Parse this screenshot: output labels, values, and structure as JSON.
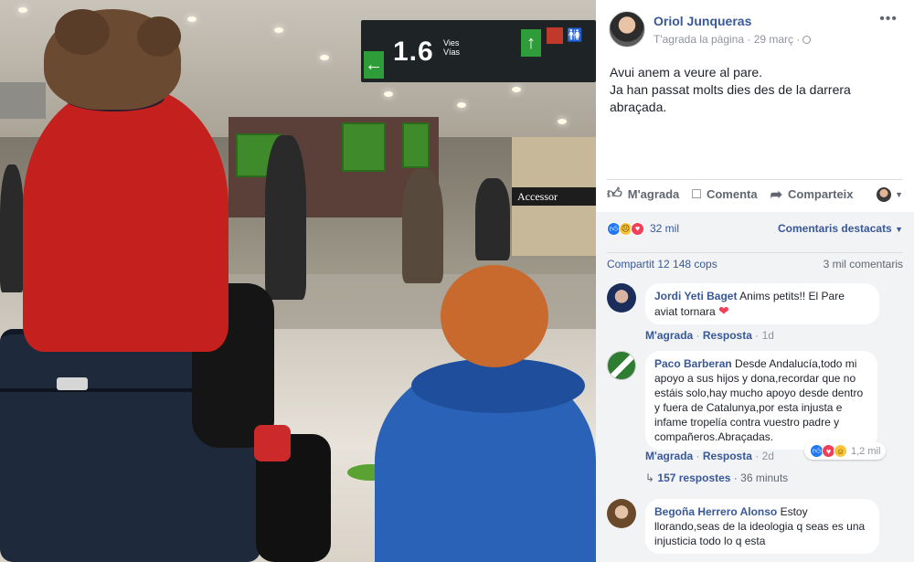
{
  "photo": {
    "sign": {
      "number": "1.6",
      "small_top": "Vies",
      "small_bottom": "Vías"
    },
    "store_sign": "Accessor"
  },
  "post": {
    "author": "Oriol Junqueras",
    "subtitle": "T'agrada la pàgina · 29 març ·",
    "more_icon": "more-options-icon",
    "text_line1": "Avui anem a veure al pare.",
    "text_line2": "Ja han passat molts dies des de la darrera abraçada."
  },
  "actions": {
    "like": "M'agrada",
    "comment": "Comenta",
    "share": "Comparteix"
  },
  "stats": {
    "reactions_count": "32 mil",
    "top_comments": "Comentaris destacats",
    "shares": "Compartit 12 148 cops",
    "comments": "3 mil comentaris"
  },
  "comments": [
    {
      "name": "Jordi Yeti Baget",
      "text": "Anims petits!! El Pare aviat tornara",
      "like": "M'agrada",
      "reply": "Resposta",
      "time": "1d"
    },
    {
      "name": "Paco Barberan",
      "text": "Desde Andalucía,todo mi apoyo a sus hijos y dona,recordar que no estáis solo,hay mucho apoyo desde dentro y fuera de Catalunya,por esta injusta e infame tropelía contra vuestro padre y compañeros.Abraçadas.",
      "like": "M'agrada",
      "reply": "Resposta",
      "time": "2d",
      "reaction_count": "1,2 mil",
      "replies": "157 respostes",
      "replies_time": "36 minuts"
    },
    {
      "name": "Begoña Herrero Alonso",
      "text": "Estoy llorando,seas de la ideologia q seas es una injusticia todo lo q esta"
    }
  ],
  "colors": {
    "link": "#385898",
    "like_blue": "#2078f4",
    "love_red": "#f33e58",
    "comment_bg": "#f2f3f5"
  }
}
